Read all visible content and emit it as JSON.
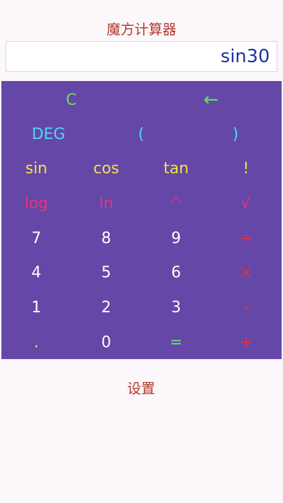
{
  "app": {
    "title": "魔方计算器",
    "settings_label": "设置"
  },
  "display": {
    "value": "sin30"
  },
  "colors": {
    "panel": "#6547a8",
    "green": "#5fe85a",
    "cyan": "#4fd8f2",
    "yellow": "#f3e246",
    "pink": "#e9337c",
    "white": "#ffffff",
    "red": "#e8303b",
    "title": "#b23a2b",
    "display_text": "#1e2fa8"
  },
  "keys": {
    "clear": "C",
    "backspace": "←",
    "deg": "DEG",
    "paren_open": "(",
    "paren_close": ")",
    "sin": "sin",
    "cos": "cos",
    "tan": "tan",
    "factorial": "!",
    "log": "log",
    "ln": "ln",
    "power": "^",
    "sqrt": "√",
    "seven": "7",
    "eight": "8",
    "nine": "9",
    "divide": "÷",
    "four": "4",
    "five": "5",
    "six": "6",
    "multiply": "×",
    "one": "1",
    "two": "2",
    "three": "3",
    "minus": "-",
    "dot": ".",
    "zero": "0",
    "equals": "=",
    "plus": "+"
  }
}
